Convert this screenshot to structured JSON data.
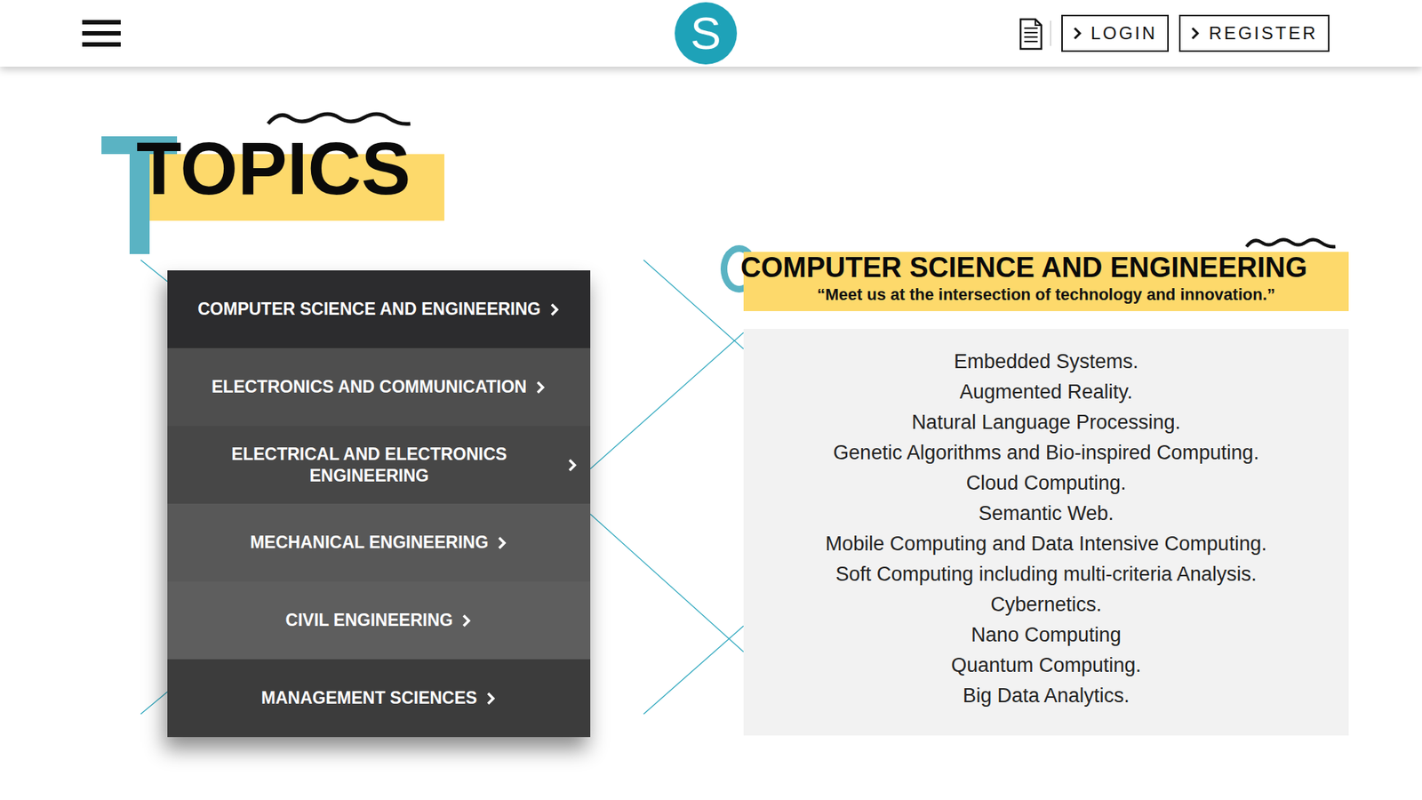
{
  "header": {
    "logo": "S",
    "buttons": [
      {
        "label": "LOGIN"
      },
      {
        "label": "REGISTER"
      }
    ]
  },
  "page_title": "TOPICS",
  "topics": [
    {
      "label": "COMPUTER SCIENCE AND ENGINEERING",
      "selected": true
    },
    {
      "label": "ELECTRONICS AND COMMUNICATION",
      "selected": false
    },
    {
      "label": "ELECTRICAL AND ELECTRONICS ENGINEERING",
      "selected": false
    },
    {
      "label": "MECHANICAL ENGINEERING",
      "selected": false
    },
    {
      "label": "CIVIL ENGINEERING",
      "selected": false
    },
    {
      "label": "MANAGEMENT SCIENCES",
      "selected": false
    }
  ],
  "detail": {
    "title": "COMPUTER SCIENCE AND ENGINEERING",
    "tagline": "“Meet us at the intersection of technology and innovation.”",
    "items": [
      "Embedded Systems.",
      "Augmented Reality.",
      "Natural Language Processing.",
      "Genetic Algorithms and Bio-inspired Computing.",
      "Cloud Computing.",
      "Semantic Web.",
      "Mobile Computing and Data Intensive Computing.",
      "Soft Computing including multi-criteria Analysis.",
      "Cybernetics.",
      "Nano Computing",
      "Quantum Computing.",
      "Big Data Analytics."
    ]
  }
}
